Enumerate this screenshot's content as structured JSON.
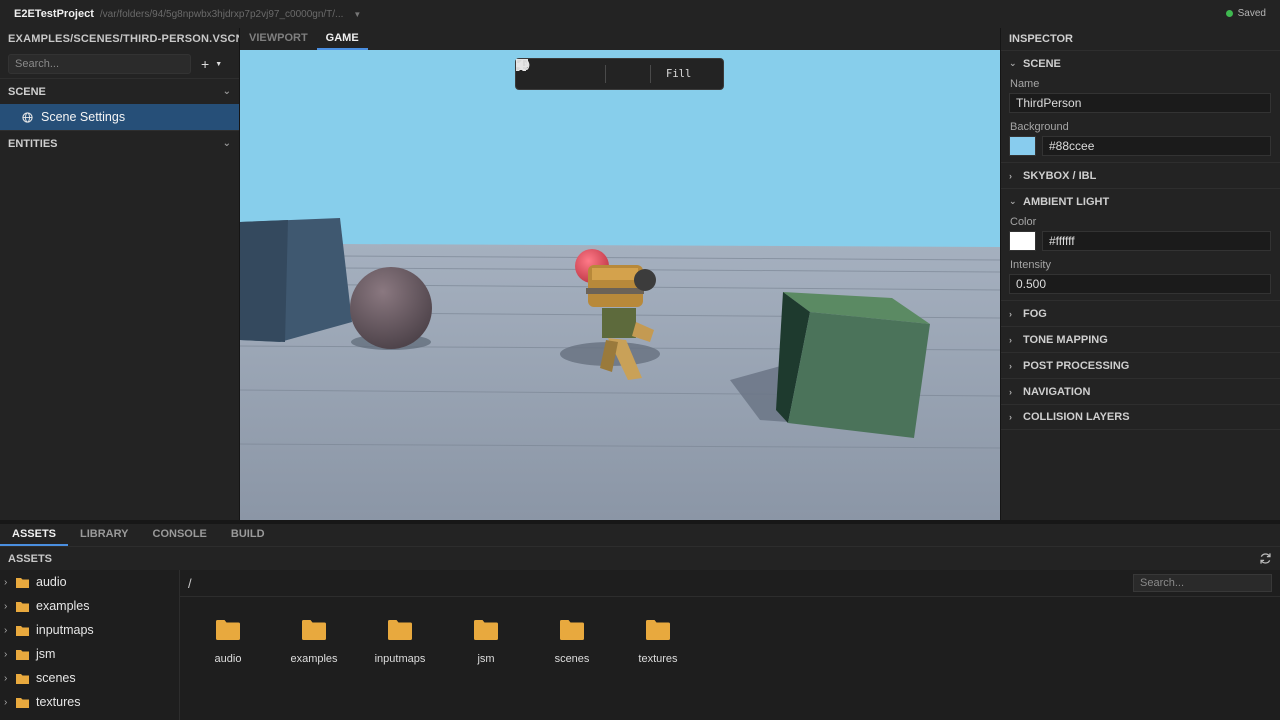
{
  "titlebar": {
    "project": "E2ETestProject",
    "path": "/var/folders/94/5g8npwbx3hjdrxp7p2vj97_c0000gn/T/...",
    "status": "Saved",
    "status_color": "#3fb950"
  },
  "left": {
    "file_title": "EXAMPLES/SCENES/THIRD-PERSON.VSCN",
    "search_placeholder": "Search...",
    "add_icon": "plus-icon",
    "scene_header": "SCENE",
    "scene_item": "Scene Settings",
    "scene_item_icon": "globe-icon",
    "entities_header": "ENTITIES"
  },
  "center": {
    "tabs": [
      {
        "label": "VIEWPORT",
        "active": false
      },
      {
        "label": "GAME",
        "active": true
      }
    ],
    "toolbar": {
      "fill_label": "Fill",
      "icons": [
        "pause-icon",
        "stop-icon",
        "volume-icon",
        "monitor-icon"
      ]
    },
    "sky_color": "#88ccee",
    "accent": "#4a8fe0"
  },
  "inspector": {
    "title": "INSPECTOR",
    "scene_section": "SCENE",
    "name_label": "Name",
    "name_value": "ThirdPerson",
    "background_label": "Background",
    "background_value": "#88ccee",
    "skybox_section": "SKYBOX / IBL",
    "ambient_section": "AMBIENT LIGHT",
    "color_label": "Color",
    "color_value": "#ffffff",
    "intensity_label": "Intensity",
    "intensity_value": "0.500",
    "collapsed_sections": [
      "FOG",
      "TONE MAPPING",
      "POST PROCESSING",
      "NAVIGATION",
      "COLLISION LAYERS"
    ]
  },
  "bottom": {
    "tabs": [
      {
        "label": "ASSETS",
        "active": true
      },
      {
        "label": "LIBRARY",
        "active": false
      },
      {
        "label": "CONSOLE",
        "active": false
      },
      {
        "label": "BUILD",
        "active": false
      }
    ],
    "assets_header": "ASSETS",
    "path": "/",
    "search_placeholder": "Search...",
    "tree": [
      "audio",
      "examples",
      "inputmaps",
      "jsm",
      "scenes",
      "textures"
    ],
    "folders": [
      "audio",
      "examples",
      "inputmaps",
      "jsm",
      "scenes",
      "textures"
    ],
    "folder_color": "#e8a93e"
  }
}
